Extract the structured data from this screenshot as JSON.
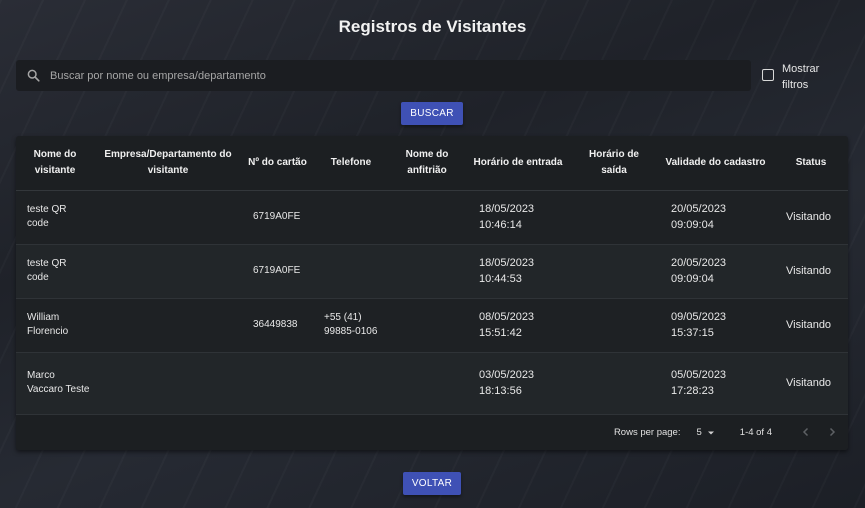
{
  "page": {
    "title": "Registros de Visitantes"
  },
  "search": {
    "placeholder": "Buscar por nome ou empresa/departamento",
    "value": ""
  },
  "filters": {
    "label": "Mostrar filtros",
    "checked": false
  },
  "buttons": {
    "search_label": "BUSCAR",
    "back_label": "VOLTAR"
  },
  "table": {
    "columns": [
      "Nome do visitante",
      "Empresa/Departamento do visitante",
      "Nº do cartão",
      "Telefone",
      "Nome do anfitrião",
      "Horário de entrada",
      "Horário de saída",
      "Validade do cadastro",
      "Status"
    ],
    "rows": [
      {
        "name": "teste QR code",
        "company": "",
        "card": "6719A0FE",
        "phone": "",
        "host": "",
        "entry": "18/05/2023 10:46:14",
        "exit": "",
        "validity": "20/05/2023 09:09:04",
        "status": "Visitando"
      },
      {
        "name": "teste QR code",
        "company": "",
        "card": "6719A0FE",
        "phone": "",
        "host": "",
        "entry": "18/05/2023 10:44:53",
        "exit": "",
        "validity": "20/05/2023 09:09:04",
        "status": "Visitando"
      },
      {
        "name": "William Florencio",
        "company": "",
        "card": "36449838",
        "phone": "+55 (41) 99885-0106",
        "host": "",
        "entry": "08/05/2023 15:51:42",
        "exit": "",
        "validity": "09/05/2023 15:37:15",
        "status": "Visitando"
      },
      {
        "name": "Marco Vaccaro Teste",
        "company": "",
        "card": "",
        "phone": "",
        "host": "",
        "entry": "03/05/2023 18:13:56",
        "exit": "",
        "validity": "05/05/2023 17:28:23",
        "status": "Visitando"
      }
    ]
  },
  "pagination": {
    "rows_per_page_label": "Rows per page:",
    "rows_per_page_value": "5",
    "range": "1-4 of 4"
  },
  "icons": {
    "search": "search-icon",
    "dropdown": "caret-down-icon",
    "prev": "chevron-left-icon",
    "next": "chevron-right-icon"
  },
  "colors": {
    "accent": "#3f51b5",
    "background": "#24272e",
    "surface": "#1e2124"
  }
}
